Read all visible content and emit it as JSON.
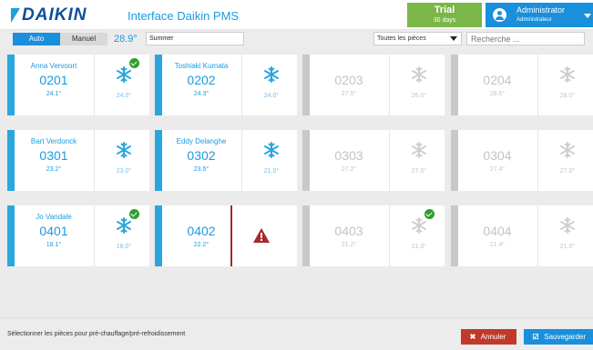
{
  "header": {
    "logo_text": "DAIKIN",
    "title": "Interface Daikin PMS",
    "trial_label": "Trial",
    "trial_days": "30 days",
    "user_name": "Administrator",
    "user_role": "Administrateur"
  },
  "toolbar": {
    "auto_label": "Auto",
    "manual_label": "Manuel",
    "outdoor_temp": "28.9°",
    "season_value": "Summer",
    "rooms_filter": "Toutes les pièces",
    "search_placeholder": "Recherche ..."
  },
  "rooms": [
    {
      "guest": "Anna Vervoort",
      "room": "0201",
      "temp": "24.1°",
      "setpoint": "24.0°",
      "active": true,
      "checked": true
    },
    {
      "guest": "Toshiaki Kumata",
      "room": "0202",
      "temp": "24.3°",
      "setpoint": "24.0°",
      "active": true,
      "checked": false
    },
    {
      "guest": "",
      "room": "0203",
      "temp": "27.5°",
      "setpoint": "26.0°",
      "active": false,
      "checked": false
    },
    {
      "guest": "",
      "room": "0204",
      "temp": "28.6°",
      "setpoint": "26.0°",
      "active": false,
      "checked": false
    },
    {
      "guest": "Bart Verdonck",
      "room": "0301",
      "temp": "23.2°",
      "setpoint": "23.0°",
      "active": true,
      "checked": false
    },
    {
      "guest": "Eddy Delanghe",
      "room": "0302",
      "temp": "23.5°",
      "setpoint": "21.0°",
      "active": true,
      "checked": false
    },
    {
      "guest": "",
      "room": "0303",
      "temp": "27.2°",
      "setpoint": "27.0°",
      "active": false,
      "checked": false
    },
    {
      "guest": "",
      "room": "0304",
      "temp": "27.4°",
      "setpoint": "27.0°",
      "active": false,
      "checked": false
    },
    {
      "guest": "Jo Vandale",
      "room": "0401",
      "temp": "18.1°",
      "setpoint": "18.0°",
      "active": true,
      "checked": true
    },
    {
      "guest": "",
      "room": "0402",
      "temp": "22.2°",
      "setpoint": "",
      "active": true,
      "checked": false,
      "alert": true
    },
    {
      "guest": "",
      "room": "0403",
      "temp": "21.2°",
      "setpoint": "21.0°",
      "active": false,
      "checked": true
    },
    {
      "guest": "",
      "room": "0404",
      "temp": "21.4°",
      "setpoint": "21.0°",
      "active": false,
      "checked": false
    }
  ],
  "footer": {
    "hint": "Sélectionner les pièces pour pré-chauffage/pré-refroidissement",
    "cancel_label": "Annuler",
    "save_label": "Sauvegarder"
  },
  "colors": {
    "brand_blue": "#1a8fdc",
    "trial_green": "#7ab648",
    "cancel_red": "#c0392b",
    "alert_red": "#a52a2a"
  }
}
